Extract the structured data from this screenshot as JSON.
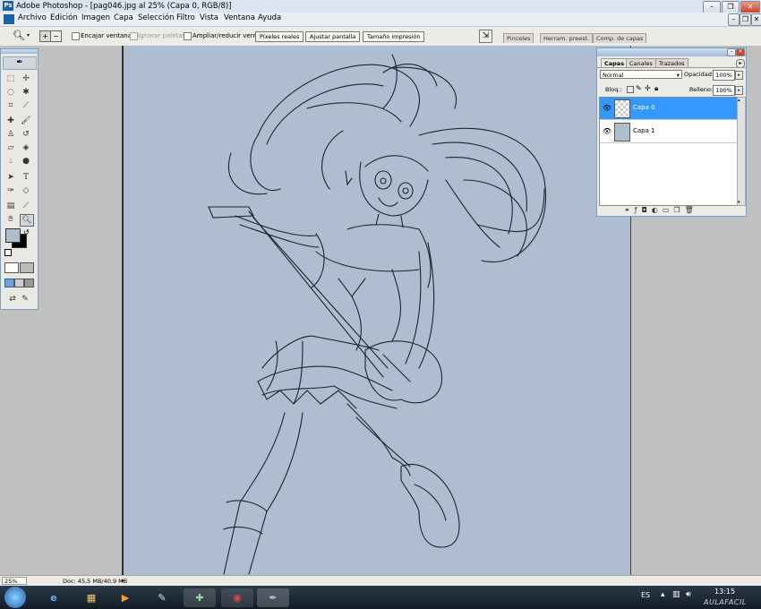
{
  "window": {
    "title": "Adobe Photoshop - [pag046.jpg al 25% (Capa 0, RGB/8)]",
    "logo": "Ps"
  },
  "menu": [
    "Archivo",
    "Edición",
    "Imagen",
    "Capa",
    "Selección",
    "Filtro",
    "Vista",
    "Ventana",
    "Ayuda"
  ],
  "options": {
    "zoom_icon": "zoom-tool-icon",
    "fit_window": "Encajar ventana",
    "ignore_palettes": "Ignorar paletas",
    "resize_windows": "Ampliar/reducir vent.",
    "actual_pixels": "Píxeles reales",
    "fit_screen": "Ajustar pantalla",
    "print_size": "Tamaño impresión"
  },
  "palette_well": [
    "Pinceles",
    "Herram. preest.",
    "Comp. de capas"
  ],
  "layers_panel": {
    "tabs": [
      "Capas",
      "Canales",
      "Trazados"
    ],
    "blend_mode": "Normal",
    "opacity_label": "Opacidad:",
    "opacity_value": "100%",
    "lock_label": "Bloq.:",
    "fill_label": "Relleno:",
    "fill_value": "100%",
    "layers": [
      {
        "name": "Capa 0",
        "selected": true
      },
      {
        "name": "Capa 1",
        "selected": false
      }
    ]
  },
  "status": {
    "zoom": "25%",
    "doc": "Doc: 45,5 MB/40,9 MB"
  },
  "taskbar": {
    "language": "ES",
    "time": "13:15",
    "watermark": "AULAFACIL"
  },
  "colors": {
    "canvas_bg": "#aebed0",
    "selected_layer": "#3399ff",
    "accent": "#316ac5"
  }
}
